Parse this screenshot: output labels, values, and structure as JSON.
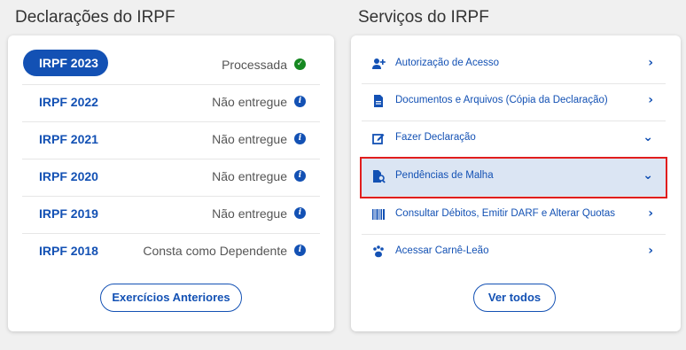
{
  "left": {
    "title": "Declarações do IRPF",
    "rows": [
      {
        "year": "IRPF 2023",
        "status": "Processada",
        "icon": "check-circle-icon"
      },
      {
        "year": "IRPF 2022",
        "status": "Não entregue",
        "icon": "info-circle-icon"
      },
      {
        "year": "IRPF 2021",
        "status": "Não entregue",
        "icon": "info-circle-icon"
      },
      {
        "year": "IRPF 2020",
        "status": "Não entregue",
        "icon": "info-circle-icon"
      },
      {
        "year": "IRPF 2019",
        "status": "Não entregue",
        "icon": "info-circle-icon"
      },
      {
        "year": "IRPF 2018",
        "status": "Consta como Dependente",
        "icon": "info-circle-icon"
      }
    ],
    "button": "Exercícios Anteriores"
  },
  "right": {
    "title": "Serviços do IRPF",
    "rows": [
      {
        "label": "Autorização de Acesso",
        "icon": "user-plus-icon",
        "chevron": "›"
      },
      {
        "label": "Documentos e Arquivos (Cópia da Declaração)",
        "icon": "document-icon",
        "chevron": "›"
      },
      {
        "label": "Fazer Declaração",
        "icon": "edit-icon",
        "chevron": "⌄"
      },
      {
        "label": "Pendências de Malha",
        "icon": "document-search-icon",
        "chevron": "⌄"
      },
      {
        "label": "Consultar Débitos, Emitir DARF e Alterar Quotas",
        "icon": "barcode-icon",
        "chevron": "›"
      },
      {
        "label": "Acessar Carnê-Leão",
        "icon": "paw-icon",
        "chevron": "›"
      }
    ],
    "button": "Ver todos"
  },
  "colors": {
    "primary": "#1351b4",
    "success": "#168821",
    "highlight_bg": "#dbe5f3",
    "highlight_border": "#e11d1d"
  }
}
